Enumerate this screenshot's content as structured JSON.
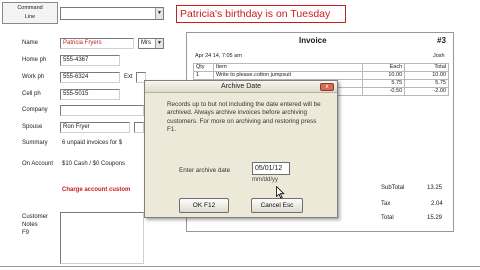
{
  "command_line": {
    "label_line1": "Command",
    "label_line2": "Line",
    "value": ""
  },
  "birthday_banner": "Patricia's birthday is on Tuesday",
  "customer": {
    "name_label": "Name",
    "name_value": "Patricia Fryers",
    "title_value": "Mrs",
    "home_label": "Home ph",
    "home_value": "555-4367",
    "work_label": "Work ph",
    "work_value": "555-6324",
    "ext_label": "Ext",
    "cell_label": "Cell ph",
    "cell_value": "555-5015",
    "company_label": "Company",
    "spouse_label": "Spouse",
    "spouse_value": "Ron Fryer",
    "summary_label": "Summary",
    "summary_value": "6 unpaid invoices for $",
    "onaccount_label": "On Account",
    "onaccount_value": "$10 Cash / $0 Coupons",
    "charge_text": "Charge account custom",
    "notes_label_1": "Customer",
    "notes_label_2": "Notes",
    "notes_label_3": "F9"
  },
  "invoice": {
    "title": "Invoice",
    "number": "#3",
    "date": "Apr 24 14, 7:05 am",
    "clerk": "Josh",
    "columns": [
      "Qty",
      "Item",
      "Each",
      "Total"
    ],
    "rows": [
      {
        "qty": "1",
        "item": "Write to please.cotton jumpsuit",
        "each": "10.00",
        "total": "10.00"
      },
      {
        "qty": "",
        "item": "",
        "each": "5.75",
        "total": "5.75"
      },
      {
        "qty": "",
        "item": "",
        "each": "-0.50",
        "total": "-2.00"
      }
    ],
    "subtotal_label": "SubTotal",
    "subtotal_value": "13.25",
    "tax_label": "Tax",
    "tax_value": "2.04",
    "total_label": "Total",
    "total_value": "15.29"
  },
  "dialog": {
    "title": "Archive Date",
    "close_glyph": "x",
    "message": "Records up to but not including the date entered will be archived. Always archive invoices before archiving customers. For more on archiving and restoring press F1.",
    "date_label": "Enter archive date",
    "date_value": "05/01/12",
    "date_format": "mm/dd/yy",
    "ok_label": "OK F12",
    "cancel_label": "Cancel Esc"
  },
  "icons": {
    "dropdown": "chevron-down-icon",
    "pointer": "mouse-pointer-icon",
    "close": "close-icon"
  },
  "colors": {
    "accent_red": "#c81e1e",
    "dialog_bg": "#ece9d8",
    "close_red": "#d96a5a"
  }
}
